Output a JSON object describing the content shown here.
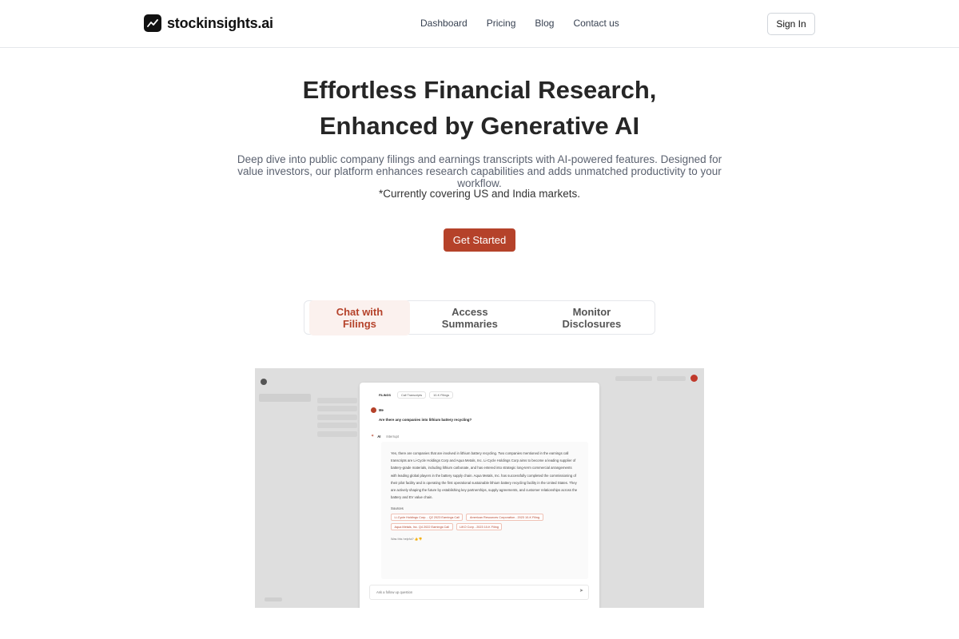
{
  "header": {
    "logo_text": "stockinsights.ai",
    "nav": [
      "Dashboard",
      "Pricing",
      "Blog",
      "Contact us"
    ],
    "signin": "Sign In"
  },
  "hero": {
    "title_line1": "Effortless Financial Research,",
    "title_line2": "Enhanced by Generative AI",
    "subtitle": "Deep dive into public company filings and earnings transcripts with AI-powered features. Designed for value investors, our platform enhances research capabilities and adds unmatched productivity to your workflow.",
    "markets_note": "*Currently covering US and India markets.",
    "cta": "Get Started"
  },
  "feature_tabs": [
    "Chat with Filings",
    "Access Summaries",
    "Monitor Disclosures"
  ],
  "preview": {
    "card_tabs": [
      "FILINGS",
      "Call Transcripts",
      "10-K Filings"
    ],
    "user_label": "Me",
    "question": "Are there any companies into lithium battery recycling?",
    "ai_label": "AI",
    "ai_status": "Interrupt",
    "answer": "Yes, there are companies that are involved in lithium battery recycling. Two companies mentioned in the earnings call transcripts are Li-Cycle Holdings Corp and Aqua Metals, Inc. Li-Cycle Holdings Corp aims to become a leading supplier of battery-grade materials, including lithium carbonate, and has entered into strategic long-term commercial arrangements with leading global players in the battery supply chain. Aqua Metals, Inc. has successfully completed the commissioning of their pilot facility and is operating the first operational sustainable lithium battery recycling facility in the United States. They are actively shaping the future by establishing key partnerships, supply agreements, and customer relationships across the battery and EV value chain.",
    "sources_label": "Sources",
    "sources": [
      "Li-Cycle Holdings Corp. - Q2 2023 Earnings Call",
      "American Resources Corporation - 2023 10-K Filing",
      "Aqua Metals, Inc. Q4 2022 Earnings Call",
      "LiKO Corp - 2023 10-K Filing"
    ],
    "helpful": "Was this helpful?",
    "followup_placeholder": "Ask a follow up question"
  },
  "colors": {
    "accent": "#b5422a",
    "accent_bg": "#fbf1ee"
  }
}
